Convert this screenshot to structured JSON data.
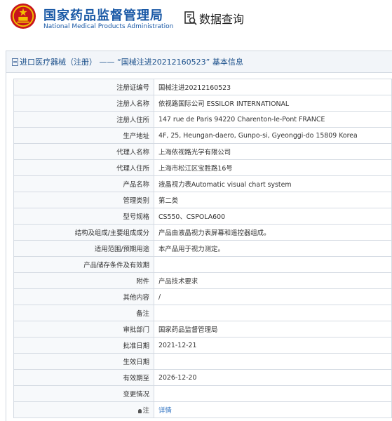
{
  "header": {
    "title_cn": "国家药品监督管理局",
    "title_en": "National Medical Products Administration",
    "search_label": "数据查询",
    "emblem_icon": "national-emblem",
    "search_icon": "document-search-icon"
  },
  "panel": {
    "title": "进口医疗器械（注册） —— “国械注进20212160523” 基本信息"
  },
  "table": {
    "rows": [
      {
        "label": "注册证编号",
        "value": "国械注进20212160523"
      },
      {
        "label": "注册人名称",
        "value": "依视路国际公司 ESSILOR INTERNATIONAL"
      },
      {
        "label": "注册人住所",
        "value": "147 rue de Paris 94220 Charenton-le-Pont FRANCE"
      },
      {
        "label": "生产地址",
        "value": "4F, 25, Heungan-daero, Gunpo-si, Gyeonggi-do 15809 Korea"
      },
      {
        "label": "代理人名称",
        "value": "上海依视路光学有限公司"
      },
      {
        "label": "代理人住所",
        "value": "上海市松江区宝胜路16号"
      },
      {
        "label": "产品名称",
        "value": "液晶视力表Automatic visual chart system"
      },
      {
        "label": "管理类别",
        "value": "第二类"
      },
      {
        "label": "型号规格",
        "value": "CS550、CSPOLA600"
      },
      {
        "label": "结构及组成/主要组成成分",
        "value": "产品由液晶视力表屏幕和遥控器组成。"
      },
      {
        "label": "适用范围/预期用途",
        "value": "本产品用于视力测定。"
      },
      {
        "label": "产品储存条件及有效期",
        "value": ""
      },
      {
        "label": "附件",
        "value": "产品技术要求"
      },
      {
        "label": "其他内容",
        "value": "/"
      },
      {
        "label": "备注",
        "value": ""
      },
      {
        "label": "审批部门",
        "value": "国家药品监督管理局"
      },
      {
        "label": "批准日期",
        "value": "2021-12-21"
      },
      {
        "label": "生效日期",
        "value": ""
      },
      {
        "label": "有效期至",
        "value": "2026-12-20"
      },
      {
        "label": "变更情况",
        "value": ""
      },
      {
        "label": "注",
        "value": "详情"
      }
    ]
  }
}
